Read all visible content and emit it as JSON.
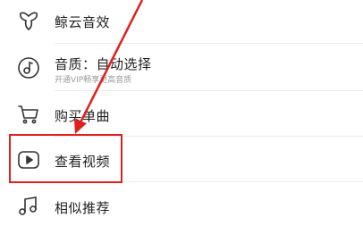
{
  "menu": {
    "items": [
      {
        "icon": "whale-cloud-icon",
        "label": "鲸云音效"
      },
      {
        "icon": "audio-quality-icon",
        "label": "音质：自动选择",
        "sub": "开通VIP畅享更高音质"
      },
      {
        "icon": "cart-icon",
        "label": "购买单曲"
      },
      {
        "icon": "play-video-icon",
        "label": "查看视频"
      },
      {
        "icon": "music-note-icon",
        "label": "相似推荐"
      }
    ]
  },
  "annotation": {
    "color": "#e0201c"
  }
}
